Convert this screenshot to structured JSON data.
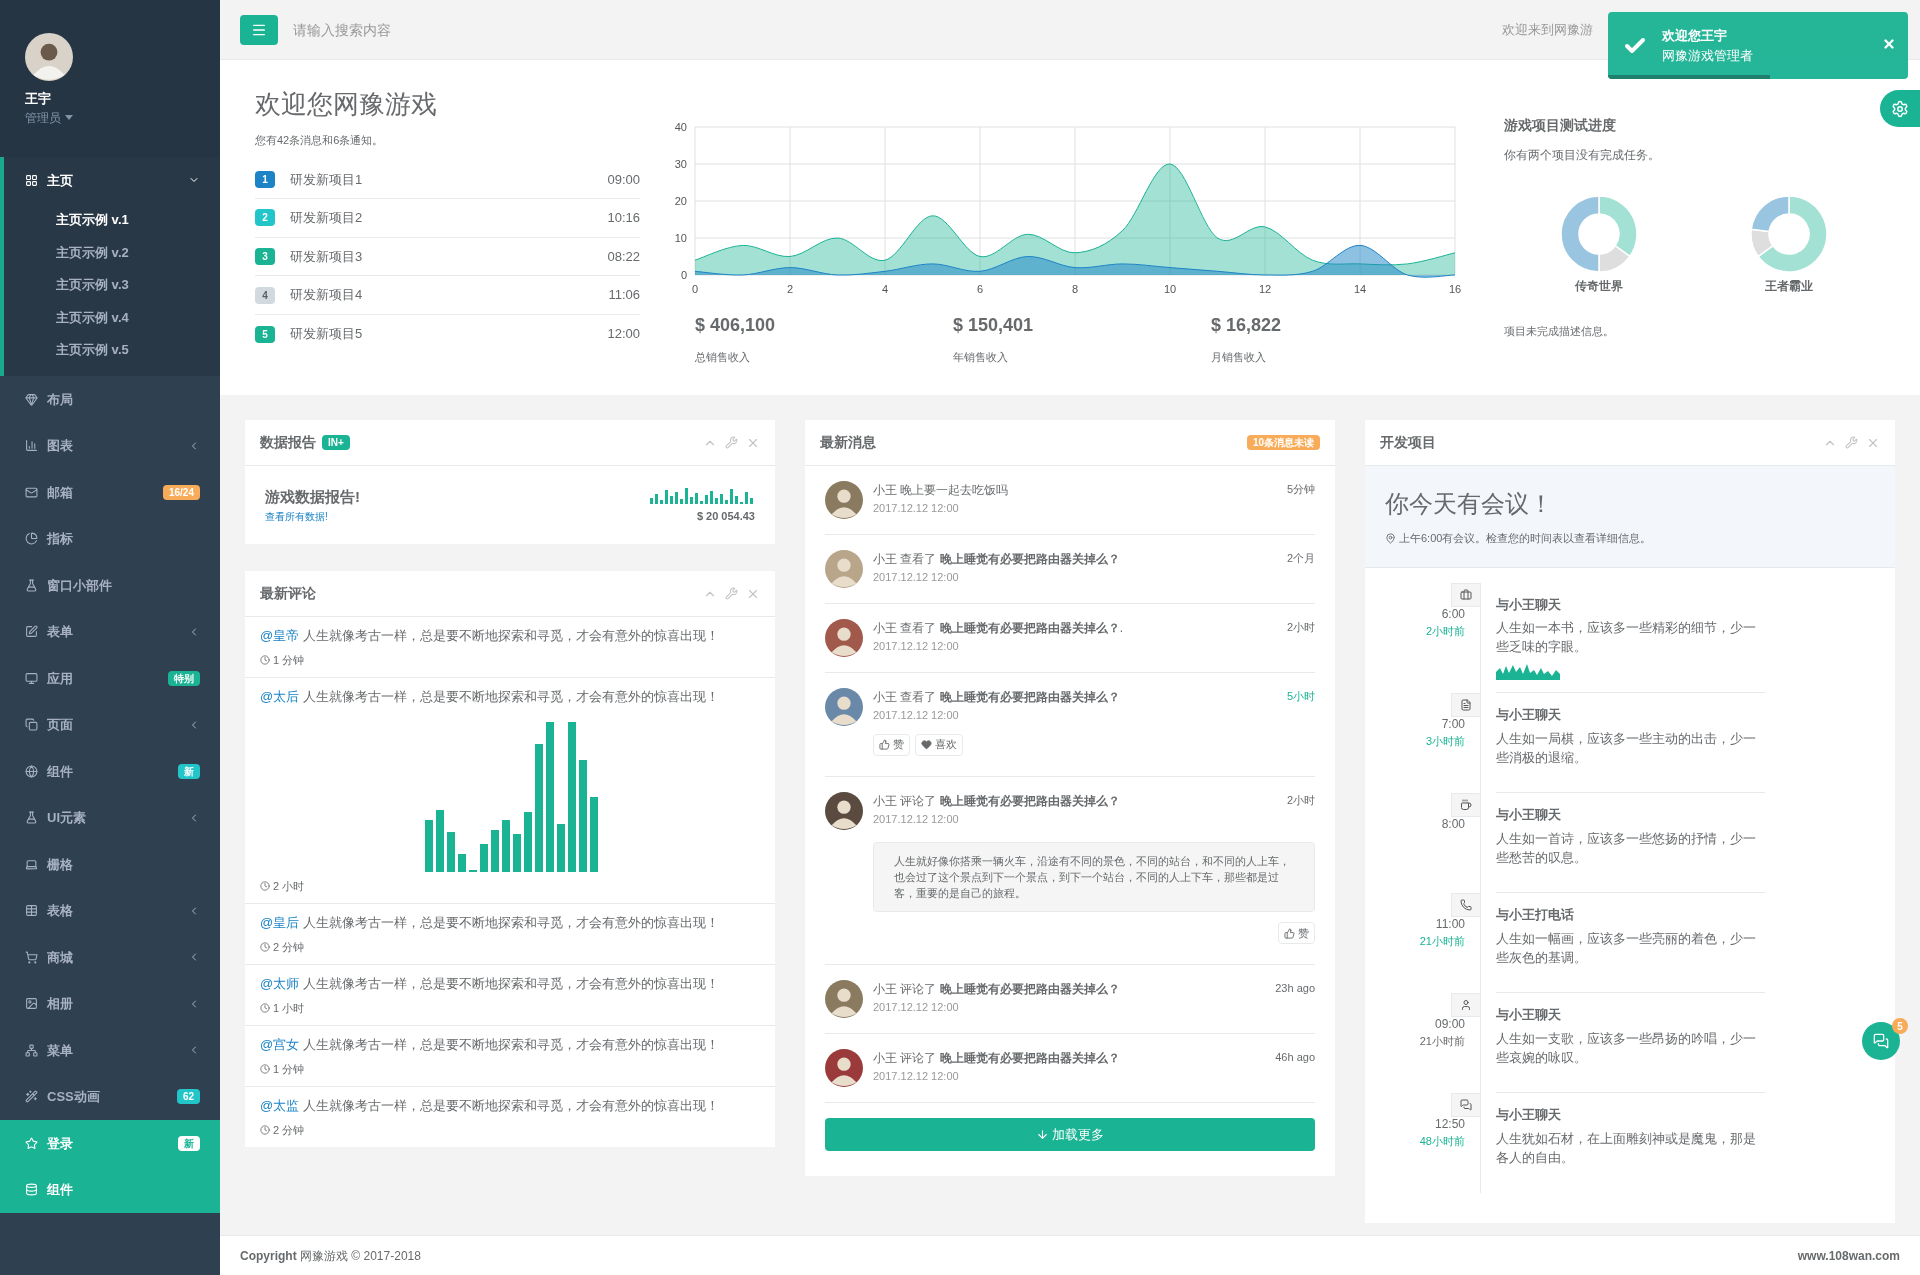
{
  "header": {
    "search": {
      "placeholder": "请输入搜索内容"
    },
    "welcome": "欢迎来到网豫游"
  },
  "toast": {
    "title": "欢迎您王宇",
    "text": "网豫游戏管理者",
    "level": 0.54
  },
  "profile": {
    "name": "王宇",
    "role": "管理员"
  },
  "sidebar": {
    "items": [
      {
        "label": "主页",
        "expanded": true,
        "selected": false,
        "children": [
          {
            "label": "主页示例 v.1",
            "selected": true
          },
          {
            "label": "主页示例 v.2",
            "selected": false
          },
          {
            "label": "主页示例 v.3",
            "selected": false
          },
          {
            "label": "主页示例 v.4",
            "selected": false
          },
          {
            "label": "主页示例 v.5",
            "selected": false
          }
        ]
      },
      {
        "label": "布局",
        "selected": false
      },
      {
        "label": "图表",
        "expanded": false,
        "selected": false
      },
      {
        "label": "邮箱",
        "badge": "16/24",
        "color": "#f8ac59",
        "selected": false
      },
      {
        "label": "指标",
        "selected": false
      },
      {
        "label": "窗口小部件",
        "selected": false
      },
      {
        "label": "表单",
        "expanded": false,
        "selected": false
      },
      {
        "label": "应用",
        "badge": "特别",
        "color": "#1ab394",
        "selected": false
      },
      {
        "label": "页面",
        "expanded": false,
        "selected": false
      },
      {
        "label": "组件",
        "badge": "新",
        "color": "#23c6c8",
        "selected": false
      },
      {
        "label": "UI元素",
        "expanded": false,
        "selected": false
      },
      {
        "label": "栅格",
        "selected": false
      },
      {
        "label": "表格",
        "expanded": false,
        "selected": false
      },
      {
        "label": "商城",
        "expanded": false,
        "selected": false
      },
      {
        "label": "相册",
        "expanded": false,
        "selected": false
      },
      {
        "label": "菜单",
        "expanded": false,
        "selected": false
      },
      {
        "label": "CSS动画",
        "badge": "62",
        "color": "#23c6c8",
        "selected": false
      },
      {
        "label": "登录",
        "badge": "新",
        "color": "#ffffff",
        "selected": true
      },
      {
        "label": "组件",
        "selected": true
      }
    ]
  },
  "welcome": {
    "title": "欢迎您网豫游戏",
    "subtitle": "您有42条消息和6条通知。",
    "projects": [
      {
        "number": "1",
        "name": "研发新项目1",
        "time": "09:00",
        "color": "#1c84c6"
      },
      {
        "number": "2",
        "name": "研发新项目2",
        "time": "10:16",
        "color": "#23c6c8"
      },
      {
        "number": "3",
        "name": "研发新项目3",
        "time": "08:22",
        "color": "#1ab394"
      },
      {
        "number": "4",
        "name": "研发新项目4",
        "time": "11:06",
        "color": "#d1dade"
      },
      {
        "number": "5",
        "name": "研发新项目5",
        "time": "12:00",
        "color": "#1ab394"
      }
    ]
  },
  "sales_chart": {
    "chart_data": {
      "type": "area",
      "x": [
        0,
        1,
        2,
        3,
        4,
        5,
        6,
        7,
        8,
        9,
        10,
        11,
        12,
        13,
        14,
        15,
        16
      ],
      "xlim": [
        0,
        16
      ],
      "ylim": [
        0,
        40
      ],
      "xticks": [
        0,
        2,
        4,
        6,
        8,
        10,
        12,
        14,
        16
      ],
      "yticks": [
        0,
        10,
        20,
        30,
        40
      ],
      "grid": true,
      "series": [
        {
          "color": "#1ab394",
          "values": [
            4,
            8,
            5,
            10,
            4,
            16,
            5,
            11,
            6,
            12,
            30,
            10,
            13,
            4,
            3,
            3,
            6
          ]
        },
        {
          "color": "#1c84c6",
          "values": [
            1,
            0,
            2,
            0,
            1,
            3,
            1,
            5,
            2,
            3,
            2,
            1,
            0,
            1,
            8,
            0,
            0
          ]
        }
      ]
    }
  },
  "stats": [
    {
      "value": "$ 406,100",
      "label": "总销售收入"
    },
    {
      "value": "$ 150,401",
      "label": "年销售收入"
    },
    {
      "value": "$ 16,822",
      "label": "月销售收入"
    }
  ],
  "progress": {
    "title": "游戏项目测试进度",
    "subtitle": "你有两个项目没有完成任务。",
    "projects": [
      "传奇世界",
      "王者霸业"
    ],
    "note": "项目未完成描述信息。"
  },
  "data_report": {
    "title": "数据报告",
    "badge": "IN+",
    "heading": "游戏数据报告!",
    "link": "查看所有数据!",
    "amount": "$ 20 054.43"
  },
  "comments": {
    "title": "最新评论",
    "items": [
      {
        "kind": "text",
        "mention": "@皇帝",
        "text": "人生就像考古一样，总是要不断地探索和寻觅，才会有意外的惊喜出现！",
        "time": "1 分钟"
      },
      {
        "kind": "chart",
        "mention": "@太后",
        "text": "人生就像考古一样，总是要不断地探索和寻觅，才会有意外的惊喜出现！",
        "time": "2 小时"
      },
      {
        "kind": "text",
        "mention": "@皇后",
        "text": "人生就像考古一样，总是要不断地探索和寻觅，才会有意外的惊喜出现！",
        "time": "2 分钟"
      },
      {
        "kind": "text",
        "mention": "@太师",
        "text": "人生就像考古一样，总是要不断地探索和寻觅，才会有意外的惊喜出现！",
        "time": "1 小时"
      },
      {
        "kind": "text",
        "mention": "@宫女",
        "text": "人生就像考古一样，总是要不断地探索和寻觅，才会有意外的惊喜出现！",
        "time": "1 分钟"
      },
      {
        "kind": "text",
        "mention": "@太监",
        "text": "人生就像考古一样，总是要不断地探索和寻觅，才会有意外的惊喜出现！",
        "time": "2 分钟"
      }
    ]
  },
  "messages": {
    "title": "最新消息",
    "badge": "10条消息未读",
    "load_more": "加载更多",
    "items": [
      {
        "user": "小王",
        "text": "晚上要一起去吃饭吗",
        "date": "2017.12.12 12:00",
        "ago": "5分钟",
        "ago_accent": false
      },
      {
        "user": "小王",
        "text": "查看了 **晚上睡觉有必要把路由器关掉么？**",
        "date": "2017.12.12 12:00",
        "ago": "2个月",
        "ago_accent": false
      },
      {
        "user": "小王",
        "text": "查看了 **晚上睡觉有必要把路由器关掉么？**.",
        "date": "2017.12.12 12:00",
        "ago": "2小时",
        "ago_accent": false
      },
      {
        "user": "小王",
        "text": "查看了 **晚上睡觉有必要把路由器关掉么？**",
        "date": "2017.12.12 12:00",
        "ago": "5小时",
        "ago_accent": true,
        "actions": [
          {
            "kind": "like",
            "label": "赞"
          },
          {
            "kind": "love",
            "label": "喜欢"
          }
        ]
      },
      {
        "user": "小王",
        "text": "评论了 **晚上睡觉有必要把路由器关掉么？**",
        "date": "2017.12.12 12:00",
        "ago": "2小时",
        "ago_accent": false,
        "quote": "人生就好像你搭乘一辆火车，沿途有不同的景色，不同的站台，和不同的人上车，也会过了这个景点到下一个景点，到下一个站台，不同的人上下车，那些都是过客，重要的是自己的旅程。",
        "actions": [
          {
            "kind": "like",
            "label": "赞"
          }
        ]
      },
      {
        "user": "小王",
        "text": "评论了 **晚上睡觉有必要把路由器关掉么？**",
        "date": "2017.12.12 12:00",
        "ago": "23h ago",
        "ago_accent": false
      },
      {
        "user": "小王",
        "text": "评论了 **晚上睡觉有必要把路由器关掉么？**",
        "date": "2017.12.12 12:00",
        "ago": "46h ago",
        "ago_accent": false
      }
    ]
  },
  "dev": {
    "title": "开发项目",
    "alert_title": "你今天有会议！",
    "alert_text": "上午6:00有会议。检查您的时间表以查看详细信息。",
    "timeline": [
      {
        "kind": "sparkline",
        "time": "6:00",
        "ago": "2小时前",
        "ago_accent": true,
        "title": "与小王聊天",
        "text": "人生如一本书，应该多一些精彩的细节，少一些乏味的字眼。"
      },
      {
        "kind": "text",
        "time": "7:00",
        "ago": "3小时前",
        "ago_accent": true,
        "title": "与小王聊天",
        "text": "人生如一局棋，应该多一些主动的出击，少一些消极的退缩。"
      },
      {
        "kind": "text",
        "time": "8:00",
        "title": "与小王聊天",
        "text": "人生如一首诗，应该多一些悠扬的抒情，少一些愁苦的叹息。"
      },
      {
        "kind": "text",
        "time": "11:00",
        "ago": "21小时前",
        "ago_accent": true,
        "title": "与小王打电话",
        "text": "人生如一幅画，应该多一些亮丽的着色，少一些灰色的基调。"
      },
      {
        "kind": "text",
        "time": "09:00",
        "ago": "21小时前",
        "ago_accent": false,
        "title": "与小王聊天",
        "text": "人生如一支歌，应该多一些昂扬的吟唱，少一些哀婉的咏叹。"
      },
      {
        "kind": "text",
        "time": "12:50",
        "ago": "48小时前",
        "ago_accent": true,
        "title": "与小王聊天",
        "text": "人生犹如石材，在上面雕刻神或是魔鬼，那是各人的自由。"
      }
    ]
  },
  "chat": {
    "badge": "5"
  },
  "footer": {
    "copyright": "**Copyright** 网豫游戏 © 2017-2018",
    "site": "www.108wan.com"
  }
}
